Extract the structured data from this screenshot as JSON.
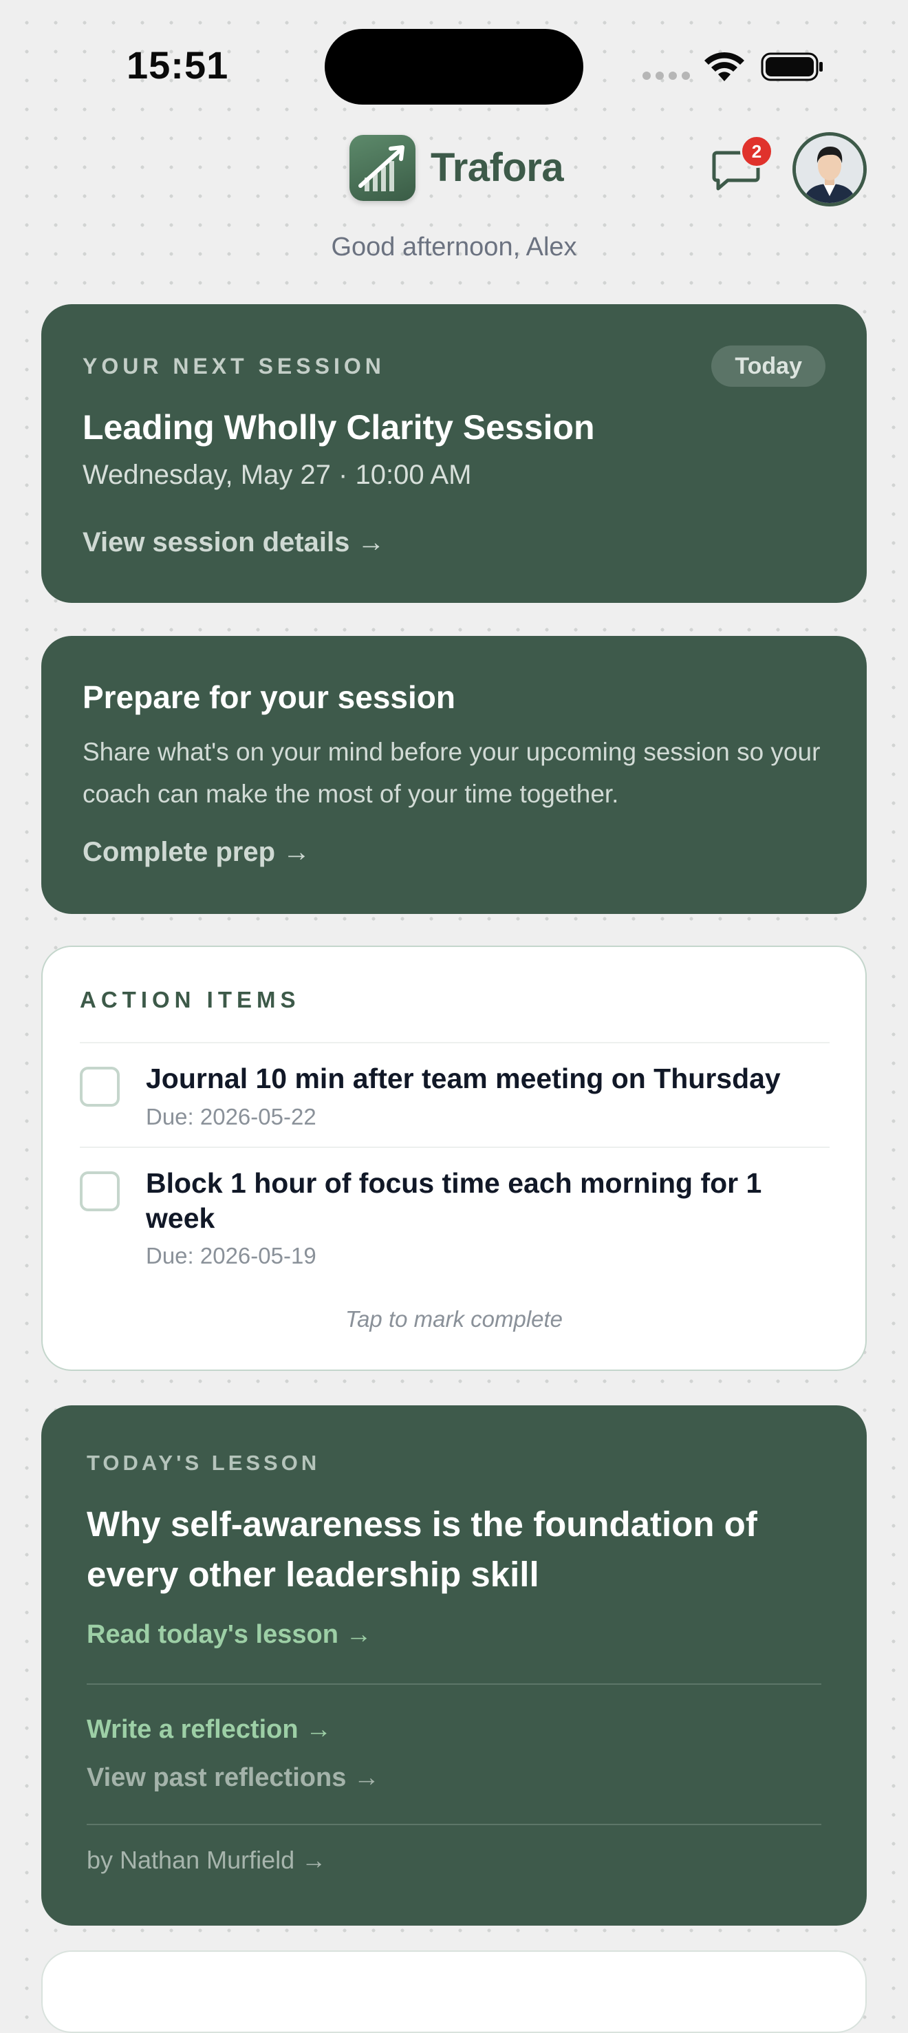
{
  "status_bar": {
    "time": "15:51"
  },
  "header": {
    "app_name": "Trafora",
    "unread_messages": "2",
    "greeting": "Good afternoon, Alex"
  },
  "next_session": {
    "eyebrow": "YOUR NEXT SESSION",
    "badge": "Today",
    "title": "Leading Wholly Clarity Session",
    "datetime": "Wednesday, May 27 · 10:00 AM",
    "link": "View session details →"
  },
  "prep": {
    "title": "Prepare for your session",
    "body": "Share what's on your mind before your upcoming session so your coach can make the most of your time together.",
    "link": "Complete prep →"
  },
  "action_items": {
    "title": "ACTION ITEMS",
    "items": [
      {
        "text": "Journal 10 min after team meeting on Thursday",
        "due": "Due: 2026-05-22"
      },
      {
        "text": "Block 1 hour of focus time each morning for 1 week",
        "due": "Due: 2026-05-19"
      }
    ],
    "hint": "Tap to mark complete"
  },
  "lesson": {
    "eyebrow": "TODAY'S LESSON",
    "title": "Why self-awareness is the foundation of every other leadership skill",
    "read_link": "Read today's lesson →",
    "reflect_link": "Write a reflection →",
    "past_link": "View past reflections →",
    "byline": "by Nathan Murfield →"
  },
  "colors": {
    "brand_green": "#3e5a4b",
    "accent_link_green": "#9dcfa6",
    "badge_red": "#e0322c",
    "background": "#efefef"
  }
}
